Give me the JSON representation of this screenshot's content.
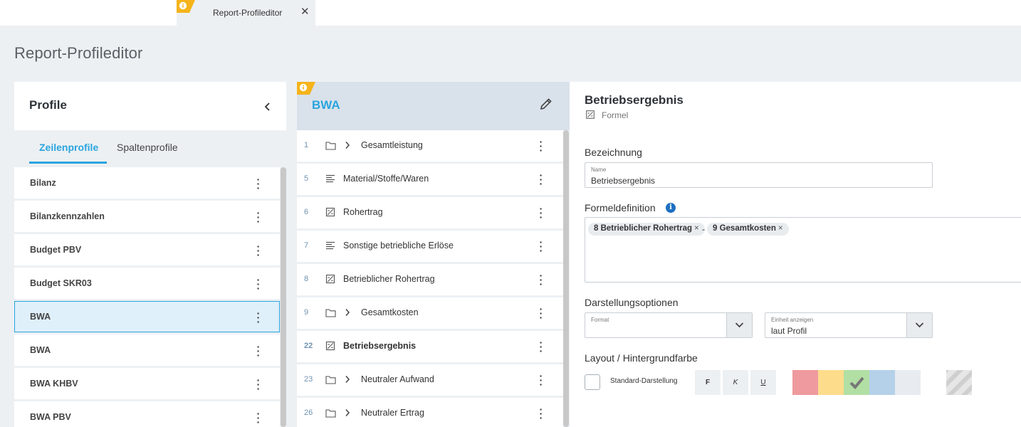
{
  "tab": {
    "label": "Report-Profileditor",
    "close": "✕"
  },
  "page": {
    "title": "Report-Profileditor"
  },
  "profiles": {
    "title": "Profile",
    "tabs": [
      "Zeilenprofile",
      "Spaltenprofile"
    ],
    "items": [
      {
        "label": "Bilanz",
        "selected": false
      },
      {
        "label": "Bilanzkennzahlen",
        "selected": false
      },
      {
        "label": "Budget PBV",
        "selected": false
      },
      {
        "label": "Budget SKR03",
        "selected": false
      },
      {
        "label": "BWA",
        "selected": true
      },
      {
        "label": "BWA",
        "selected": false
      },
      {
        "label": "BWA KHBV",
        "selected": false
      },
      {
        "label": "BWA PBV",
        "selected": false
      }
    ]
  },
  "rows": {
    "title": "BWA",
    "items": [
      {
        "num": "1",
        "icon": "folder-icon",
        "expandable": true,
        "label": "Gesamtleistung"
      },
      {
        "num": "5",
        "icon": "lines-icon",
        "expandable": false,
        "label": "Material/Stoffe/Waren"
      },
      {
        "num": "6",
        "icon": "formula-icon",
        "expandable": false,
        "label": "Rohertrag"
      },
      {
        "num": "7",
        "icon": "lines-icon",
        "expandable": false,
        "label": "Sonstige betriebliche Erlöse"
      },
      {
        "num": "8",
        "icon": "formula-icon",
        "expandable": false,
        "label": "Betrieblicher Rohertrag"
      },
      {
        "num": "9",
        "icon": "folder-icon",
        "expandable": true,
        "label": "Gesamtkosten"
      },
      {
        "num": "22",
        "icon": "formula-icon",
        "expandable": false,
        "label": "Betriebsergebnis",
        "active": true
      },
      {
        "num": "23",
        "icon": "folder-icon",
        "expandable": true,
        "label": "Neutraler Aufwand"
      },
      {
        "num": "26",
        "icon": "folder-icon",
        "expandable": true,
        "label": "Neutraler Ertrag"
      }
    ]
  },
  "detail": {
    "title": "Betriebsergebnis",
    "type": "Formel",
    "bezeichnung_label": "Bezeichnung",
    "name_field": {
      "label": "Name",
      "value": "Betriebsergebnis"
    },
    "formel_label": "Formeldefinition",
    "formula": {
      "chip1": "8 Betrieblicher Rohertrag",
      "operator": "-",
      "chip2": "9 Gesamtkosten",
      "remove": "×"
    },
    "darstellung_label": "Darstellungsoptionen",
    "format_field": {
      "label": "Format",
      "value": ""
    },
    "einheit_field": {
      "label": "Einheit anzeigen",
      "value": "laut Profil"
    },
    "layout_label": "Layout / Hintergrundfarbe",
    "standard_label": "Standard-Darstellung",
    "format_buttons": {
      "bold": "F",
      "italic": "K",
      "underline": "U"
    },
    "swatches": [
      "#ef9a9e",
      "#fddc8c",
      "#b2dfa4",
      "#b4d1e9",
      "#e8ecf1",
      "#ffffff",
      "hatched"
    ],
    "selected_swatch": "#b2dfa4"
  }
}
